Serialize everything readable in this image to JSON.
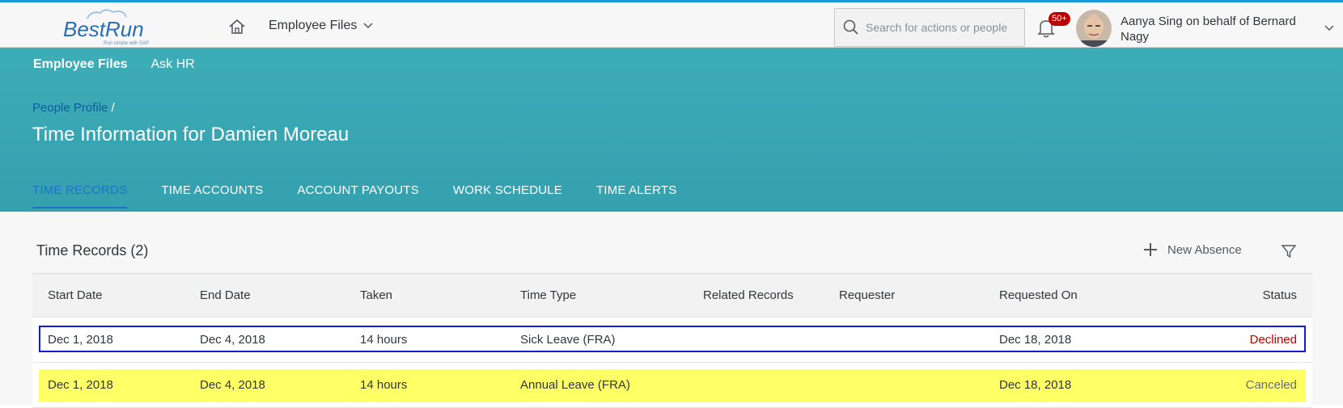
{
  "shell": {
    "logo_text": "BestRun",
    "logo_tagline": "Run simple with SAP",
    "menu_label": "Employee Files",
    "search_placeholder": "Search for actions or people",
    "notifications_badge": "50+",
    "user_label": "Aanya Sing on behalf of Bernard Nagy"
  },
  "subnav": {
    "items": [
      "Employee Files",
      "Ask HR"
    ]
  },
  "header": {
    "breadcrumb_link": "People Profile",
    "breadcrumb_sep": "/",
    "title": "Time Information for Damien Moreau"
  },
  "tabs": [
    "TIME RECORDS",
    "TIME ACCOUNTS",
    "ACCOUNT PAYOUTS",
    "WORK SCHEDULE",
    "TIME ALERTS"
  ],
  "table": {
    "title": "Time Records (2)",
    "new_absence_label": "New Absence",
    "columns": [
      "Start Date",
      "End Date",
      "Taken",
      "Time Type",
      "Related Records",
      "Requester",
      "Requested On",
      "Status"
    ],
    "rows": [
      [
        "Dec 1, 2018",
        "Dec 4, 2018",
        "14 hours",
        "Sick Leave (FRA)",
        "",
        "",
        "Dec 18, 2018",
        "Declined"
      ],
      [
        "Dec 1, 2018",
        "Dec 4, 2018",
        "14 hours",
        "Annual Leave (FRA)",
        "",
        "",
        "Dec 18, 2018",
        "Canceled"
      ]
    ]
  },
  "colors": {
    "header_bg": "#3aa9b5",
    "active_tab": "#1f73c7",
    "declined": "#bb0000",
    "highlight": "#ffff66",
    "focus_border": "#1818d8"
  },
  "icons": [
    "home-icon",
    "chevron-down-icon",
    "search-icon",
    "bell-icon",
    "plus-icon",
    "filter-icon"
  ]
}
